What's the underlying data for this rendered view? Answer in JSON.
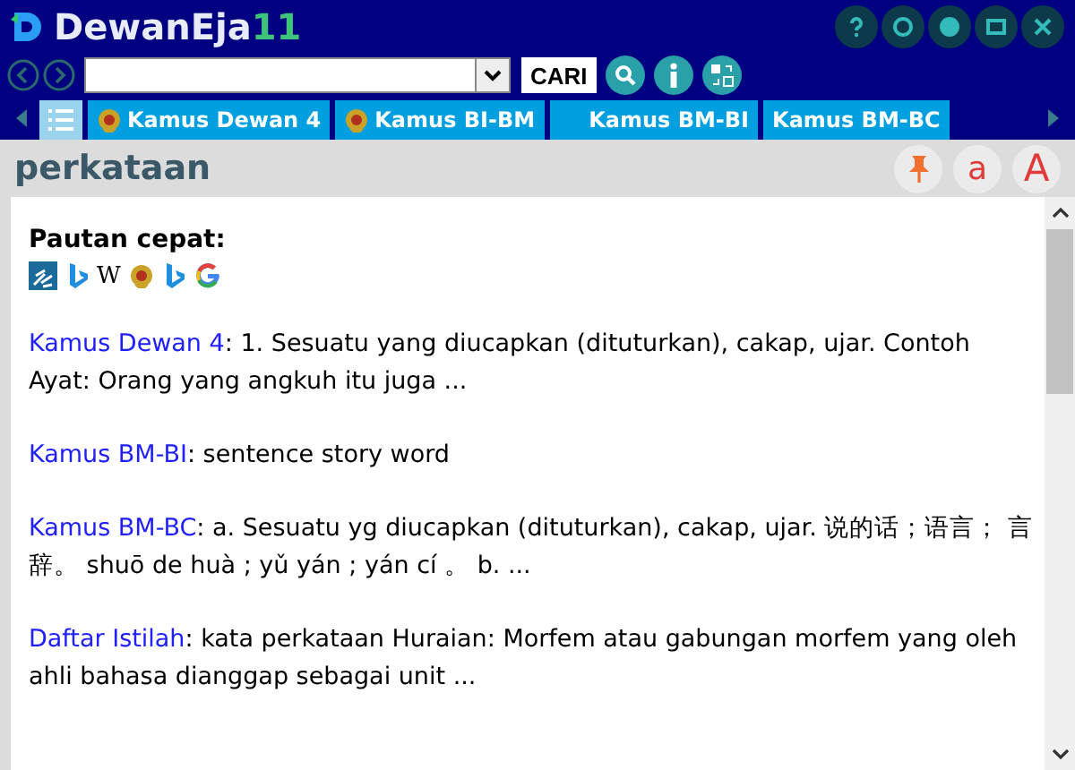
{
  "window": {
    "title": "DewanEja",
    "version": "11"
  },
  "toolbar": {
    "search_button": "CARI"
  },
  "tabs": [
    {
      "kind": "list",
      "selected": true
    },
    {
      "kind": "emblem",
      "label": "Kamus Dewan 4",
      "selected": false
    },
    {
      "kind": "emblem",
      "label": "Kamus BI-BM",
      "selected": false
    },
    {
      "kind": "blank",
      "label": "Kamus BM-BI",
      "selected": false
    },
    {
      "kind": "plain",
      "label": "Kamus BM-BC",
      "selected": false
    }
  ],
  "header": {
    "word": "perkataan",
    "buttons": [
      {
        "kind": "pin"
      },
      {
        "kind": "small",
        "label": "a"
      },
      {
        "kind": "large",
        "label": "A"
      }
    ]
  },
  "quick_links": {
    "title": "Pautan cepat:",
    "links": [
      {
        "kind": "sign"
      },
      {
        "kind": "bing"
      },
      {
        "kind": "text",
        "label": "W"
      },
      {
        "kind": "emblem"
      },
      {
        "kind": "bing"
      },
      {
        "kind": "google"
      }
    ]
  },
  "entries": [
    {
      "source": "Kamus Dewan 4",
      "text": ": 1. Sesuatu yang diucapkan (dituturkan), cakap, ujar. Contoh Ayat: Orang yang angkuh itu juga ..."
    },
    {
      "source": "Kamus BM-BI",
      "text": ": sentence story word"
    },
    {
      "source": "Kamus BM-BC",
      "text": ": a. Sesuatu yg diucapkan (dituturkan), cakap, ujar. 说的话；语言； 言辞。  shuō de huà ;  yǔ yán ;  yán cí 。   b. ..."
    },
    {
      "source": "Daftar Istilah",
      "text": ": kata perkataan Huraian: Morfem atau gabungan morfem yang oleh ahli bahasa dianggap sebagai unit ..."
    }
  ]
}
